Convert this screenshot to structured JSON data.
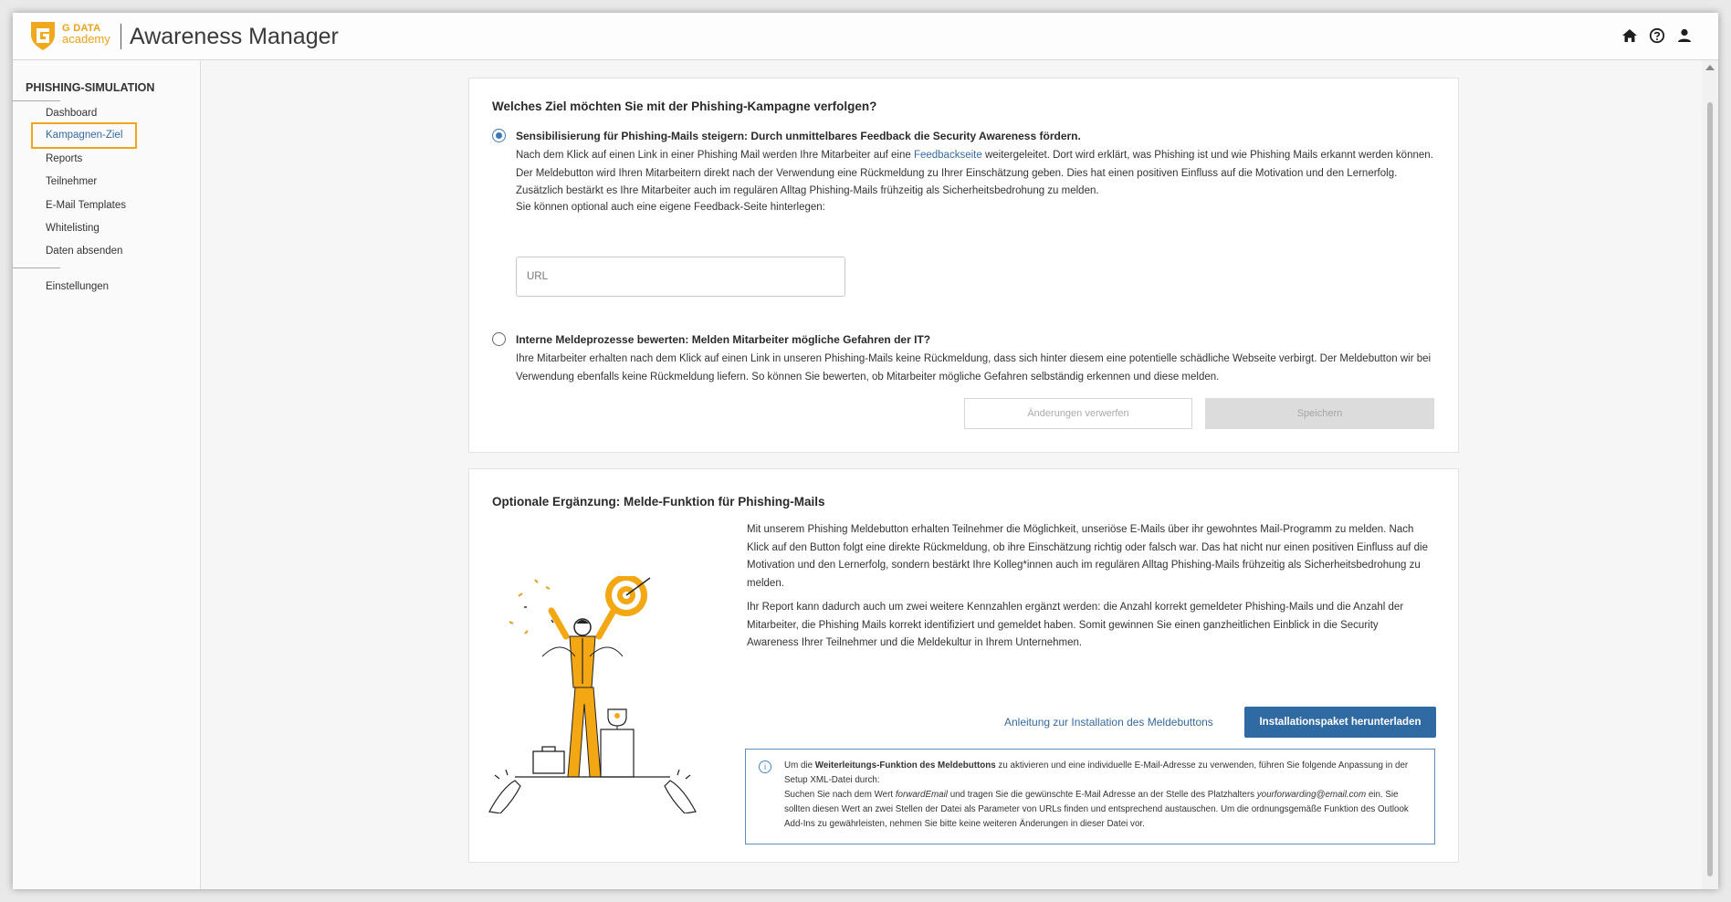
{
  "header": {
    "brand_line1": "G DATA",
    "brand_line2": "academy",
    "app_title": "Awareness Manager",
    "icons": [
      "home-icon",
      "help-icon",
      "user-icon"
    ]
  },
  "sidebar": {
    "heading": "PHISHING-SIMULATION",
    "items": [
      {
        "label": "Dashboard"
      },
      {
        "label": "Kampagnen-Ziel",
        "active": true
      },
      {
        "label": "Reports"
      },
      {
        "label": "Teilnehmer"
      },
      {
        "label": "E-Mail Templates"
      },
      {
        "label": "Whitelisting"
      },
      {
        "label": "Daten absenden"
      },
      {
        "label": "Einstellungen"
      }
    ]
  },
  "goal_card": {
    "title": "Welches Ziel möchten Sie mit der Phishing-Kampagne verfolgen?",
    "option1": {
      "label": "Sensibilisierung für Phishing-Mails steigern: Durch unmittelbares Feedback die Security Awareness fördern.",
      "text_before_link": "Nach dem Klick auf einen Link in einer Phishing Mail werden Ihre Mitarbeiter auf eine ",
      "link": "Feedbackseite",
      "text_after_link": " weitergeleitet. Dort wird erklärt, was Phishing ist und wie Phishing Mails erkannt werden können. Der Meldebutton wird Ihren Mitarbeitern direkt nach der Verwendung eine Rückmeldung zu Ihrer Einschätzung geben. Dies hat einen positiven Einfluss auf die Motivation und den Lernerfolg. Zusätzlich bestärkt es Ihre Mitarbeiter auch im regulären Alltag Phishing-Mails frühzeitig als Sicherheitsbedrohung zu melden.",
      "optional_hint": "Sie können optional auch eine eigene Feedback-Seite hinterlegen:",
      "url_placeholder": "URL"
    },
    "option2": {
      "label": "Interne Meldeprozesse bewerten: Melden Mitarbeiter mögliche Gefahren der IT?",
      "text": "Ihre Mitarbeiter erhalten nach dem Klick auf einen Link in unseren Phishing-Mails keine Rückmeldung, dass sich hinter diesem eine potentielle schädliche Webseite verbirgt. Der Meldebutton wir bei Verwendung ebenfalls keine Rückmeldung liefern. So können Sie bewerten, ob Mitarbeiter mögliche Gefahren selbständig erkennen und diese melden."
    },
    "discard_label": "Änderungen verwerfen",
    "save_label": "Speichern"
  },
  "report_card": {
    "title": "Optionale Ergänzung: Melde-Funktion für Phishing-Mails",
    "para1": "Mit unserem Phishing Meldebutton erhalten Teilnehmer die Möglichkeit, unseriöse E-Mails über ihr gewohntes Mail-Programm zu melden. Nach Klick auf den Button folgt eine direkte Rückmeldung, ob ihre Einschätzung richtig oder falsch war. Das hat nicht nur einen positiven Einfluss auf die Motivation und den Lernerfolg, sondern bestärkt Ihre Kolleg*innen auch im regulären Alltag Phishing-Mails frühzeitig als Sicherheitsbedrohung zu melden.",
    "para2": "Ihr Report kann dadurch auch um zwei weitere Kennzahlen ergänzt werden: die Anzahl korrekt gemeldeter Phishing-Mails und die Anzahl der Mitarbeiter, die Phishing Mails korrekt identifiziert und gemeldet haben. Somit gewinnen Sie einen ganzheitlichen Einblick in die Security Awareness Ihrer Teilnehmer und die Meldekultur in Ihrem Unternehmen.",
    "install_guide_link": "Anleitung zur Installation des Meldebuttons",
    "download_button": "Installationspaket herunterladen",
    "info": {
      "t1": "Um die ",
      "t1_bold": "Weiterleitungs-Funktion des Meldebuttons",
      "t2": " zu aktivieren und eine individuelle E-Mail-Adresse zu verwenden, führen Sie folgende Anpassung in der Setup XML-Datei durch:",
      "t3": "Suchen Sie nach dem Wert ",
      "t3_italic": "forwardEmail",
      "t4": " und tragen Sie die gewünschte E-Mail Adresse an der Stelle des Platzhalters ",
      "t4_italic": "yourforwarding@email.com",
      "t5": " ein. Sie sollten diesen Wert an zwei Stellen der Datei als Parameter von URLs finden und entsprechend austauschen. Um die ordnungsgemäße Funktion des Outlook Add-Ins zu gewährleisten, nehmen Sie bitte keine weiteren Änderungen in dieser Datei vor."
    }
  },
  "colors": {
    "accent": "#2f6aa3",
    "active_border": "#efa51c",
    "brand": "#e8a317",
    "link": "#356aa0"
  }
}
